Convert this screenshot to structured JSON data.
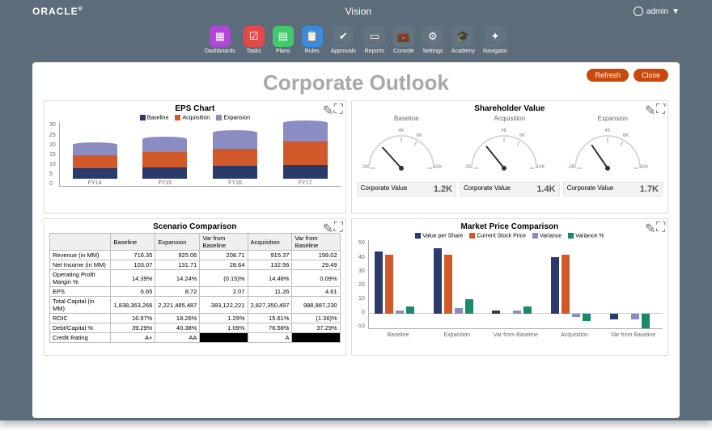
{
  "brand": "ORACLE",
  "app_title": "Vision",
  "user": {
    "name": "admin",
    "dropdown_icon": "▼"
  },
  "nav": [
    {
      "label": "Dashboards",
      "color": "#b147d8"
    },
    {
      "label": "Tasks",
      "color": "#e24a4a"
    },
    {
      "label": "Plans",
      "color": "#42c96b"
    },
    {
      "label": "Rules",
      "color": "#3a8be0"
    },
    {
      "label": "Approvals",
      "color": "#647380"
    },
    {
      "label": "Reports",
      "color": "#647380"
    },
    {
      "label": "Console",
      "color": "#647380"
    },
    {
      "label": "Settings",
      "color": "#647380"
    },
    {
      "label": "Academy",
      "color": "#647380"
    },
    {
      "label": "Navigator",
      "color": "#647380"
    }
  ],
  "page_title": "Corporate Outlook",
  "buttons": {
    "refresh": "Refresh",
    "close": "Close"
  },
  "panel_tools": {
    "edit": "✎",
    "expand": "⛶"
  },
  "eps_panel": {
    "title": "EPS Chart",
    "legend": [
      {
        "name": "Baseline",
        "color": "#2a3a6a"
      },
      {
        "name": "Acquisition",
        "color": "#d25a2a"
      },
      {
        "name": "Expansion",
        "color": "#8a8cc2"
      }
    ]
  },
  "shareholder_panel": {
    "title": "Shareholder Value",
    "gauges": [
      {
        "name": "Baseline",
        "label": "Corporate Value",
        "value": "1.2K",
        "ticks": [
          "-2K",
          "4K",
          "6K",
          "10K"
        ]
      },
      {
        "name": "Acquisition",
        "label": "Corporate Value",
        "value": "1.4K",
        "ticks": [
          "-2K",
          "4K",
          "6K",
          "10K"
        ]
      },
      {
        "name": "Expansion",
        "label": "Corporate Value",
        "value": "1.7K",
        "ticks": [
          "-2K",
          "4K",
          "6K",
          "10K"
        ]
      }
    ]
  },
  "scenario_panel": {
    "title": "Scenario Comparison",
    "headers": [
      "",
      "Baseline",
      "Expansion",
      "Var from Baseline",
      "Acquisition",
      "Var from Baseline"
    ],
    "rows": [
      {
        "label": "Revenue (in MM)",
        "c": [
          "716.35",
          "925.06",
          "208.71",
          "915.37",
          "199.02"
        ]
      },
      {
        "label": "Net Income (in MM)",
        "c": [
          "103.07",
          "131.71",
          "28.64",
          "132.56",
          "29.49"
        ]
      },
      {
        "label": "Operating Profit Margin %",
        "c": [
          "14.39%",
          "14.24%",
          "(0.15)%",
          "14.48%",
          "0.09%"
        ]
      },
      {
        "label": "EPS",
        "c": [
          "6.65",
          "8.72",
          "2.07",
          "11.26",
          "4.61"
        ]
      },
      {
        "label": "Total Capital (in MM)",
        "c": [
          "1,838,363,266",
          "2,221,485,487",
          "383,122,221",
          "2,827,350,497",
          "988,987,230"
        ]
      },
      {
        "label": "ROIC",
        "c": [
          "16.97%",
          "18.26%",
          "1.29%",
          "15.61%",
          "(1.36)%"
        ]
      },
      {
        "label": "Debt/Capital %",
        "c": [
          "39.29%",
          "40.38%",
          "1.09%",
          "76.58%",
          "37.29%"
        ]
      },
      {
        "label": "Credit Rating",
        "c": [
          "A+",
          "AA",
          "__BLACK__",
          "A",
          "__BLACK__"
        ]
      }
    ]
  },
  "market_panel": {
    "title": "Market Price Comparison",
    "legend": [
      {
        "name": "Value per Share",
        "color": "#2a3a6a"
      },
      {
        "name": "Current Stock Price",
        "color": "#d25a2a"
      },
      {
        "name": "Variance",
        "color": "#8a8cc2"
      },
      {
        "name": "Variance %",
        "color": "#1a8a6a"
      }
    ]
  },
  "chart_data": [
    {
      "type": "bar",
      "id": "eps_chart",
      "title": "EPS Chart",
      "stacked": true,
      "categories": [
        "FY14",
        "FY15",
        "FY16",
        "FY17"
      ],
      "ylabel": "",
      "ylim": [
        0,
        30
      ],
      "yticks": [
        0,
        5,
        10,
        15,
        20,
        25,
        30
      ],
      "series": [
        {
          "name": "Baseline",
          "color": "#2a3a6a",
          "values": [
            5,
            5.5,
            6,
            6.5
          ]
        },
        {
          "name": "Acquisition",
          "color": "#d25a2a",
          "values": [
            6,
            7,
            8,
            11
          ]
        },
        {
          "name": "Expansion",
          "color": "#8a8cc2",
          "values": [
            5,
            6,
            7.5,
            8.5
          ]
        }
      ]
    },
    {
      "type": "gauge",
      "id": "shareholder_value",
      "title": "Shareholder Value",
      "range": [
        -2000,
        10000
      ],
      "ticks": [
        -2000,
        4000,
        6000,
        10000
      ],
      "series": [
        {
          "name": "Baseline",
          "value": 1200
        },
        {
          "name": "Acquisition",
          "value": 1400
        },
        {
          "name": "Expansion",
          "value": 1700
        }
      ]
    },
    {
      "type": "bar",
      "id": "market_price_comparison",
      "title": "Market Price Comparison",
      "categories": [
        "Baseline",
        "Expansion",
        "Var from Baseline",
        "Acquisition",
        "Var from Baseline"
      ],
      "ylim": [
        -10,
        50
      ],
      "yticks": [
        -10,
        0,
        10,
        20,
        30,
        40,
        50
      ],
      "series": [
        {
          "name": "Value per Share",
          "color": "#2a3a6a",
          "values": [
            42,
            44,
            2,
            38,
            -4
          ]
        },
        {
          "name": "Current Stock Price",
          "color": "#d25a2a",
          "values": [
            40,
            40,
            0,
            40,
            0
          ]
        },
        {
          "name": "Variance",
          "color": "#8a8cc2",
          "values": [
            2,
            4,
            2,
            -2,
            -4
          ]
        },
        {
          "name": "Variance %",
          "color": "#1a8a6a",
          "values": [
            5,
            10,
            5,
            -5,
            -10
          ]
        }
      ]
    }
  ]
}
